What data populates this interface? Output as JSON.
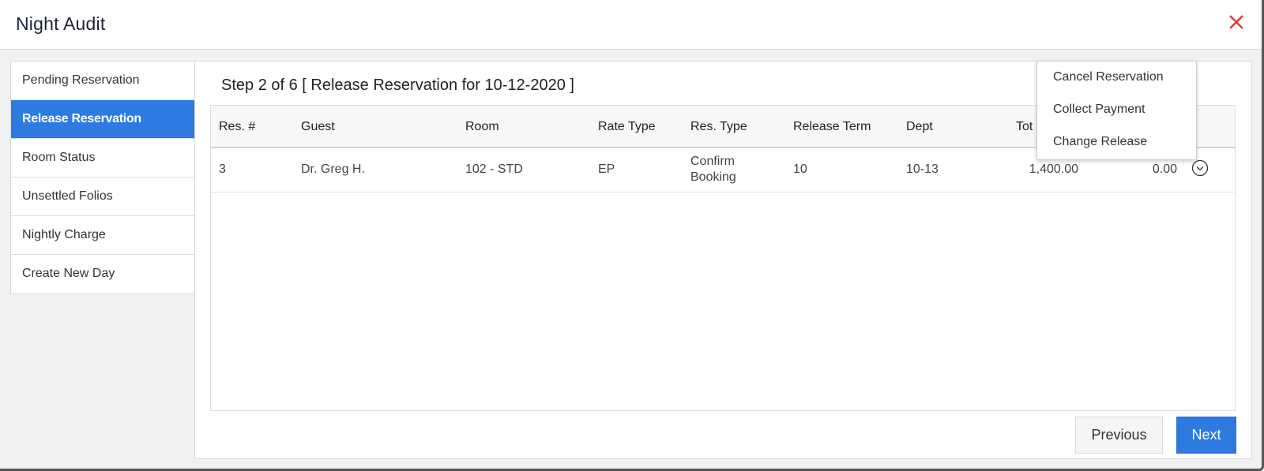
{
  "modal": {
    "title": "Night Audit",
    "close_icon": "close-x-icon",
    "close_color": "#d9403a"
  },
  "sidebar": {
    "items": [
      {
        "label": "Pending Reservation",
        "active": false
      },
      {
        "label": "Release Reservation",
        "active": true
      },
      {
        "label": "Room Status",
        "active": false
      },
      {
        "label": "Unsettled Folios",
        "active": false
      },
      {
        "label": "Nightly Charge",
        "active": false
      },
      {
        "label": "Create New Day",
        "active": false
      }
    ],
    "active_color": "#2d7be0"
  },
  "main": {
    "step_title": "Step 2 of 6 [ Release Reservation for 10-12-2020 ]",
    "table": {
      "headers": [
        "Res. #",
        "Guest",
        "Room",
        "Rate Type",
        "Res. Type",
        "Release Term",
        "Dept",
        "Tot"
      ],
      "rows": [
        {
          "res_no": "3",
          "guest": "Dr. Greg H.",
          "room": "102 - STD",
          "rate_type": "EP",
          "res_type_line1": "Confirm",
          "res_type_line2": "Booking",
          "release_term": "10",
          "dept": "10-13",
          "total": "1,400.00",
          "paid": "0.00",
          "action_icon": "chevron-down-circle-icon"
        }
      ]
    },
    "row_menu": {
      "items": [
        "Cancel Reservation",
        "Collect Payment",
        "Change Release"
      ]
    },
    "buttons": {
      "previous": "Previous",
      "next": "Next"
    }
  }
}
